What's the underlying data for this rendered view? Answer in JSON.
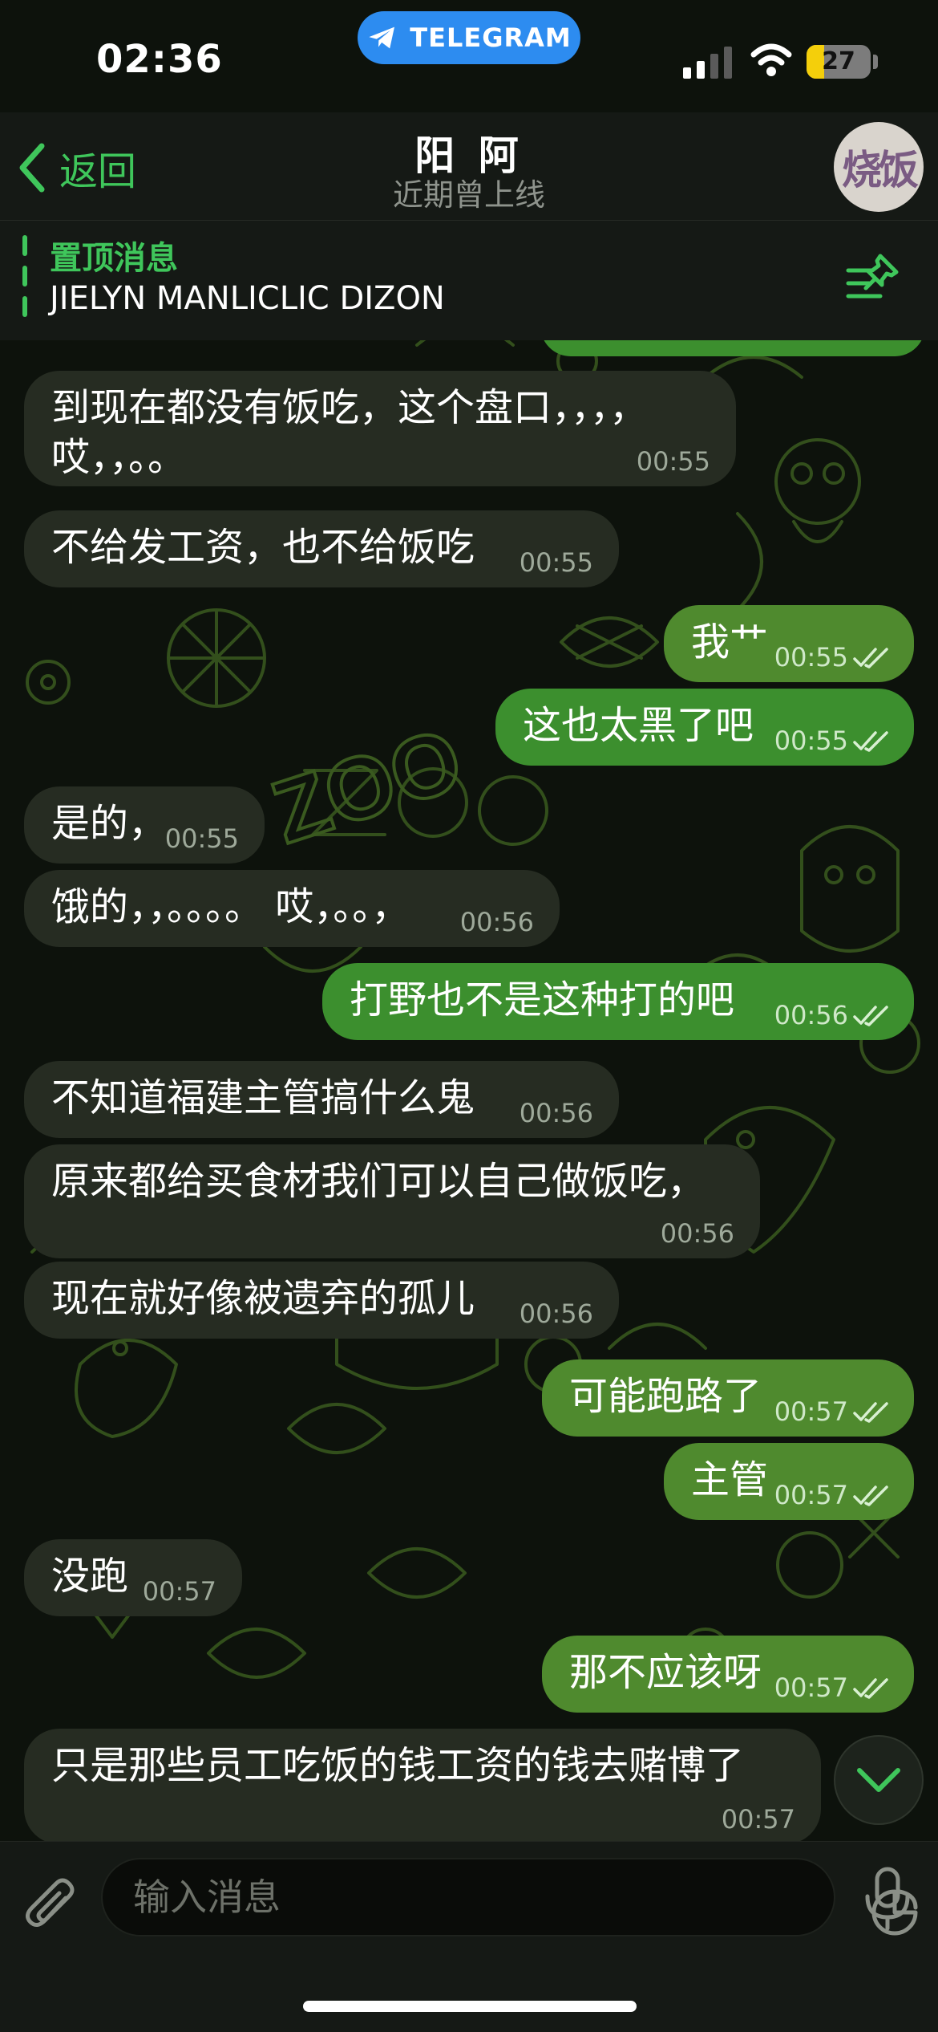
{
  "status_bar": {
    "time": "02:36",
    "app_pill": "TELEGRAM",
    "battery": "27",
    "battery_level": 0.27
  },
  "header": {
    "back_label": "返回",
    "title": "阳 阿",
    "subtitle": "近期曾上线",
    "avatar_text": "烧饭"
  },
  "pinned": {
    "label": "置顶消息",
    "text": "JIELYN MANLICLIC DIZON"
  },
  "messages": [
    {
      "dir": "in",
      "lines": [
        "到现在都没有饭吃，这个盘口，，，，",
        "哎，，。。"
      ],
      "time": "00:55"
    },
    {
      "dir": "in",
      "lines": [
        "不给发工资，也不给饭吃"
      ],
      "time": "00:55"
    },
    {
      "dir": "out",
      "lines": [
        "我艹"
      ],
      "time": "00:55"
    },
    {
      "dir": "out",
      "lines": [
        "这也太黑了吧"
      ],
      "time": "00:55"
    },
    {
      "dir": "in",
      "lines": [
        "是的，"
      ],
      "time": "00:55"
    },
    {
      "dir": "in",
      "lines": [
        "饿的，，。。。。 哎，。。，"
      ],
      "time": "00:56"
    },
    {
      "dir": "out",
      "lines": [
        "打野也不是这种打的吧"
      ],
      "time": "00:56"
    },
    {
      "dir": "in",
      "lines": [
        "不知道福建主管搞什么鬼"
      ],
      "time": "00:56"
    },
    {
      "dir": "in",
      "lines": [
        "原来都给买食材我们可以自己做饭吃，"
      ],
      "time": "00:56"
    },
    {
      "dir": "in",
      "lines": [
        "现在就好像被遗弃的孤儿"
      ],
      "time": "00:56"
    },
    {
      "dir": "out",
      "lines": [
        "可能跑路了"
      ],
      "time": "00:57"
    },
    {
      "dir": "out",
      "lines": [
        "主管"
      ],
      "time": "00:57"
    },
    {
      "dir": "in",
      "lines": [
        "没跑"
      ],
      "time": "00:57"
    },
    {
      "dir": "out",
      "lines": [
        "那不应该呀"
      ],
      "time": "00:57"
    },
    {
      "dir": "in",
      "lines": [
        "只是那些员工吃饭的钱工资的钱去赌博了"
      ],
      "time": "00:57"
    }
  ],
  "input": {
    "placeholder": "输入消息"
  },
  "icons": {
    "back": "chevron-left-icon",
    "pin_list": "pin-list-icon",
    "attach": "paperclip-icon",
    "sticker": "sticker-icon",
    "mic": "microphone-icon",
    "scroll": "chevron-down-icon"
  },
  "colors": {
    "accent": "#3fc65b",
    "outgoing_bubble": "#3c8f2e",
    "incoming_bubble": "#262c22",
    "telegram_blue": "#2d8cf0",
    "battery_yellow": "#f4cf0b"
  }
}
